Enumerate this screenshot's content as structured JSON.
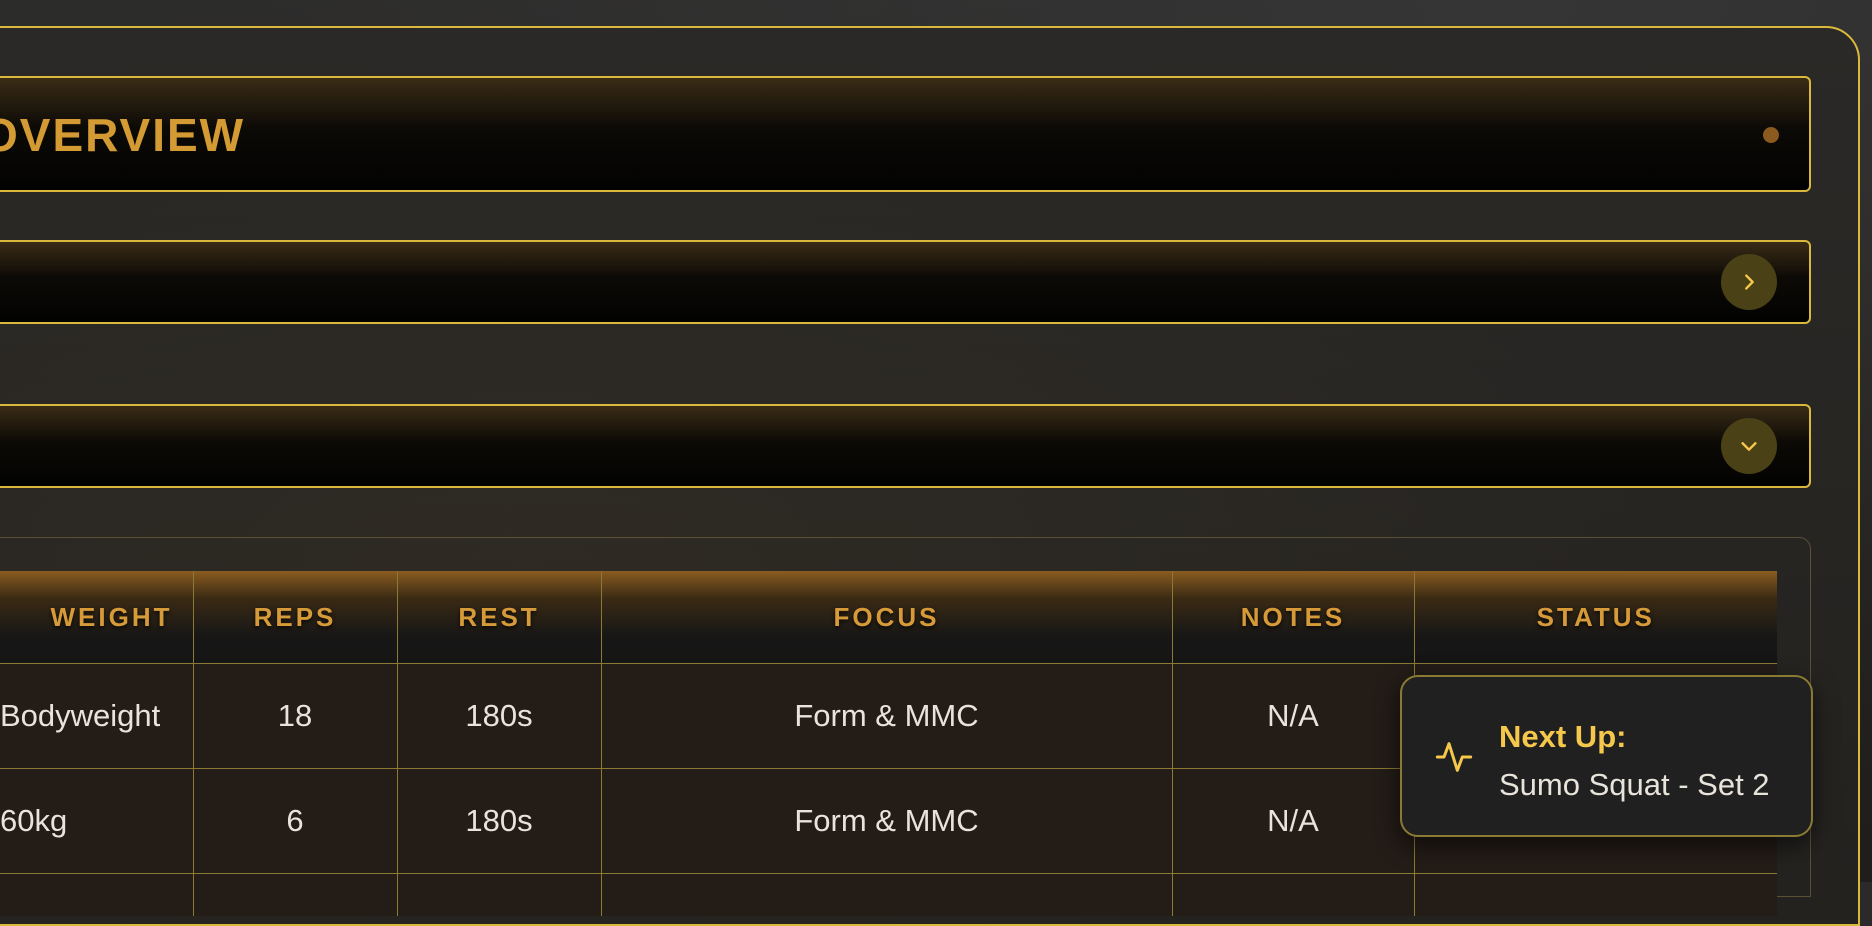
{
  "header": {
    "title": "OVERVIEW"
  },
  "table": {
    "columns": [
      "WEIGHT",
      "REPS",
      "REST",
      "FOCUS",
      "NOTES",
      "STATUS"
    ],
    "rows": [
      {
        "weight": "Bodyweight",
        "reps": "18",
        "rest": "180s",
        "focus": "Form & MMC",
        "notes": "N/A",
        "status": ""
      },
      {
        "weight": "60kg",
        "reps": "6",
        "rest": "180s",
        "focus": "Form & MMC",
        "notes": "N/A",
        "status": ""
      }
    ]
  },
  "toast": {
    "title": "Next Up:",
    "message": "Sumo Squat - Set 2",
    "icon": "activity-icon"
  },
  "icons": {
    "section1_button": "chevron-right-icon",
    "section2_button": "chevron-down-icon",
    "header_indicator": "status-dot"
  },
  "colors": {
    "accent_gold": "#d9b83b",
    "heading_orange": "#d49a33",
    "toast_title": "#f5c84b"
  }
}
